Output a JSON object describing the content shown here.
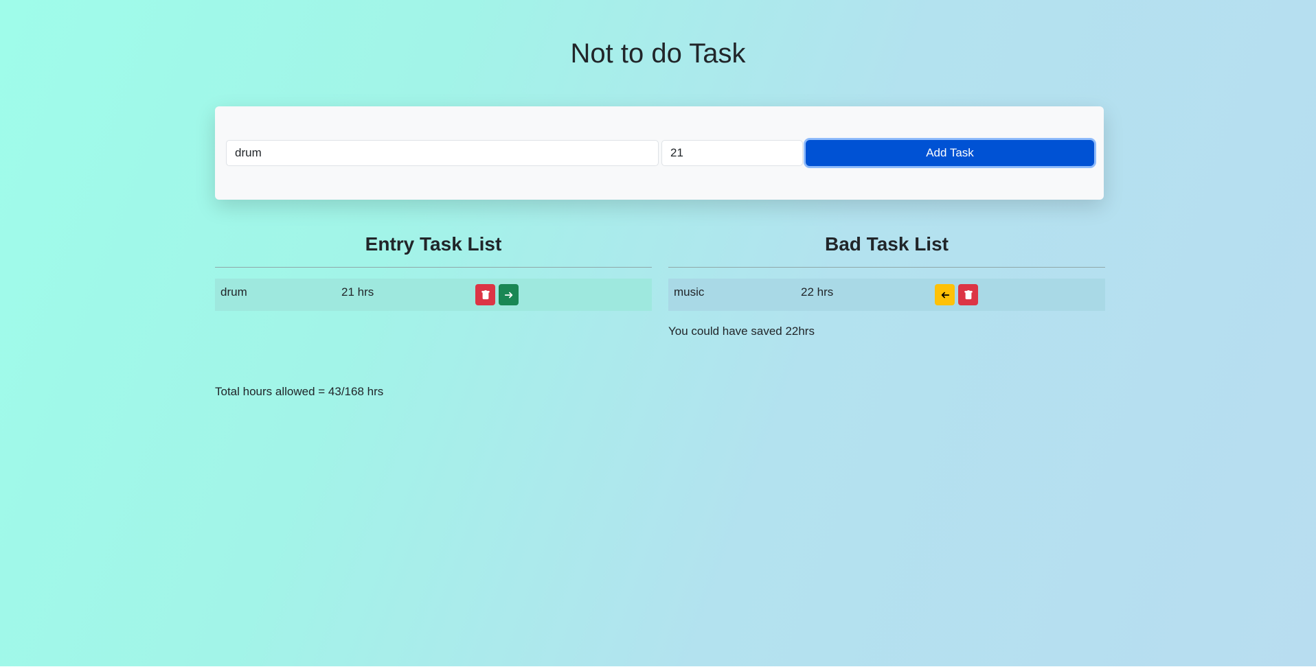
{
  "page": {
    "title": "Not to do Task"
  },
  "form": {
    "task_value": "drum",
    "hours_value": "21",
    "add_label": "Add Task"
  },
  "entry_list": {
    "heading": "Entry Task List",
    "items": [
      {
        "task": "drum",
        "hours": "21 hrs"
      }
    ]
  },
  "bad_list": {
    "heading": "Bad Task List",
    "items": [
      {
        "task": "music",
        "hours": "22 hrs"
      }
    ],
    "saved_text": "You could have saved 22hrs"
  },
  "summary": {
    "total_text": "Total hours allowed = 43/168 hrs"
  },
  "colors": {
    "primary": "#0052d4",
    "danger": "#dc3545",
    "success": "#198754",
    "warning": "#ffc107"
  },
  "icons": {
    "delete": "trash-icon",
    "move_right": "arrow-right-icon",
    "move_left": "arrow-left-icon"
  }
}
